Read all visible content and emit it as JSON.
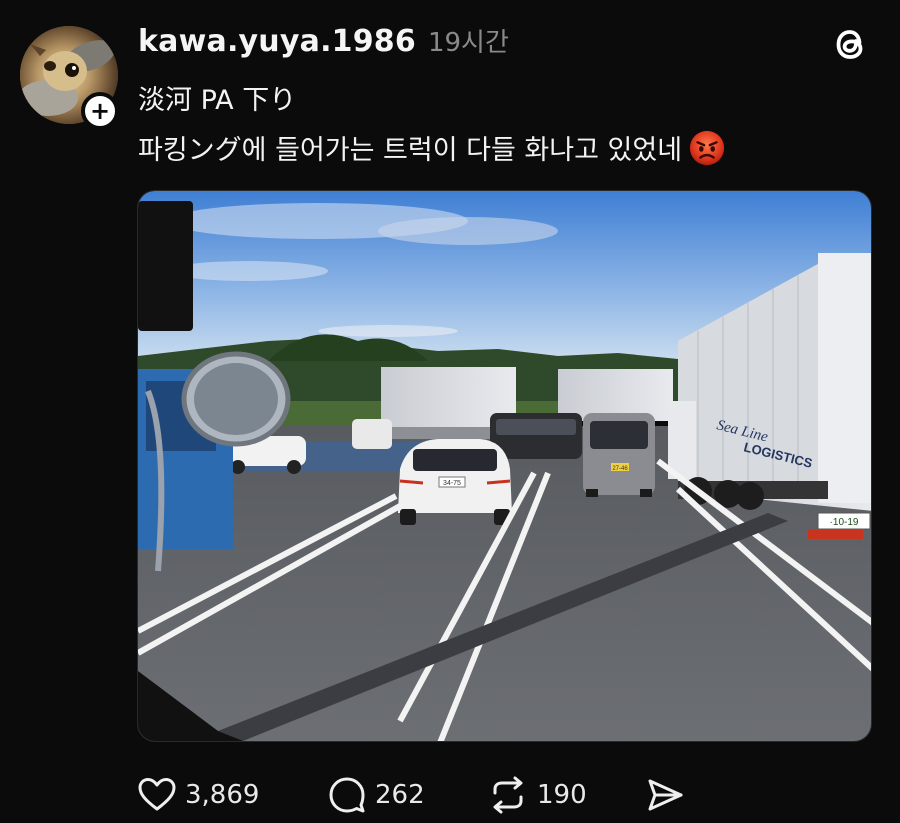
{
  "post": {
    "username": "kawa.yuya.1986",
    "timestamp": "19시간",
    "follow_symbol": "+",
    "line1": "淡河 PA 下り",
    "line2": "파킹ング에 들어가는 트럭이 다들 화나고 있었네",
    "emoji_name": "angry-face-emoji"
  },
  "app": {
    "logo_name": "threads-logo-icon"
  },
  "photo": {
    "truck_plate": "·10-19",
    "car_plate": "34-75",
    "van_plate": "27-46",
    "truck_logo": "LOGISTICS",
    "truck_script": "Sea Line"
  },
  "actions": {
    "like_count": "3,869",
    "reply_count": "262",
    "repost_count": "190"
  },
  "colors": {
    "background": "#0b0b0b",
    "text": "#f3f3f3",
    "muted": "#8a8a8a"
  }
}
